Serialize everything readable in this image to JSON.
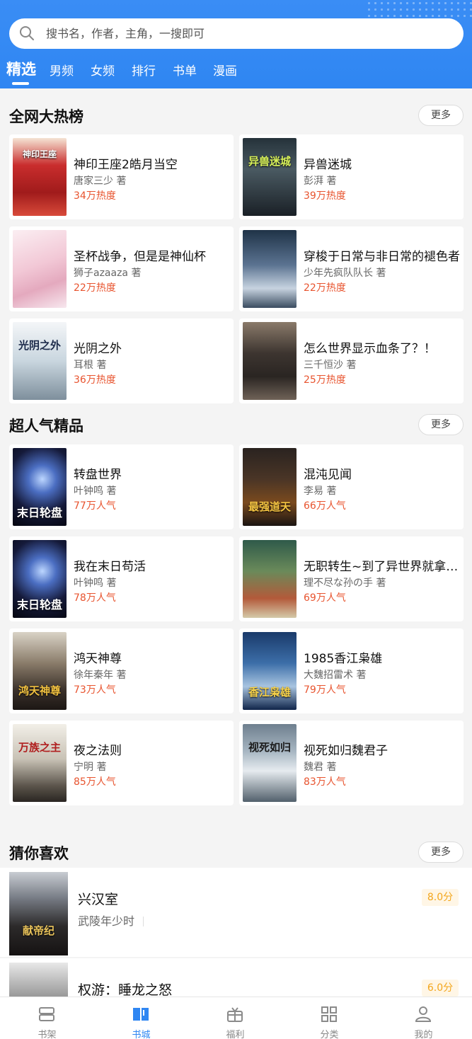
{
  "search": {
    "placeholder": "搜书名，作者，主角，一搜即可"
  },
  "tabs": [
    {
      "label": "精选",
      "active": true
    },
    {
      "label": "男频"
    },
    {
      "label": "女频"
    },
    {
      "label": "排行"
    },
    {
      "label": "书单"
    },
    {
      "label": "漫画"
    }
  ],
  "hot": {
    "title": "全网大热榜",
    "more": "更多",
    "books": [
      {
        "title": "神印王座2皓月当空",
        "author": "唐家三少 著",
        "stat": "34万热度",
        "cover_text": "神印王座"
      },
      {
        "title": "异兽迷城",
        "author": "彭湃 著",
        "stat": "39万热度",
        "cover_text": "异兽迷城"
      },
      {
        "title": "圣杯战争，但是是神仙杯",
        "author": "狮子azaaza 著",
        "stat": "22万热度",
        "cover_text": ""
      },
      {
        "title": "穿梭于日常与非日常的褪色者",
        "author": "少年先疯队队长 著",
        "stat": "22万热度",
        "cover_text": ""
      },
      {
        "title": "光阴之外",
        "author": "耳根 著",
        "stat": "36万热度",
        "cover_text": "光阴之外"
      },
      {
        "title": "怎么世界显示血条了？！",
        "author": "三千恒沙 著",
        "stat": "25万热度",
        "cover_text": ""
      }
    ]
  },
  "popular": {
    "title": "超人气精品",
    "more": "更多",
    "books": [
      {
        "title": "转盘世界",
        "author": "叶钟鸣 著",
        "stat": "77万人气",
        "cover_text": "末日轮盘"
      },
      {
        "title": "混沌见闻",
        "author": "李易 著",
        "stat": "66万人气",
        "cover_text": "最强道天"
      },
      {
        "title": "我在末日苟活",
        "author": "叶钟鸣 著",
        "stat": "78万人气",
        "cover_text": "末日轮盘"
      },
      {
        "title": "无职转生~到了异世界就拿出真本事~",
        "author": "理不尽な孙の手 著",
        "stat": "69万人气",
        "cover_text": ""
      },
      {
        "title": "鸿天神尊",
        "author": "徐年秦年 著",
        "stat": "73万人气",
        "cover_text": "鸿天神尊"
      },
      {
        "title": "1985香江枭雄",
        "author": "大魏招雷术 著",
        "stat": "79万人气",
        "cover_text": "香江枭雄"
      },
      {
        "title": "夜之法则",
        "author": "宁明 著",
        "stat": "85万人气",
        "cover_text": "万族之主"
      },
      {
        "title": "视死如归魏君子",
        "author": "魏君 著",
        "stat": "83万人气",
        "cover_text": "视死如归"
      }
    ]
  },
  "guess": {
    "title": "猜你喜欢",
    "more": "更多",
    "books": [
      {
        "title": "兴汉室",
        "author": "武陵年少时",
        "score": "8.0分",
        "cover_text": "献帝纪"
      },
      {
        "title": "权游：睡龙之怒",
        "author": "",
        "score": "6.0分",
        "cover_text": ""
      }
    ]
  },
  "nav": [
    {
      "label": "书架",
      "icon": "bookshelf-icon"
    },
    {
      "label": "书城",
      "icon": "book-city-icon",
      "active": true
    },
    {
      "label": "福利",
      "icon": "gift-icon"
    },
    {
      "label": "分类",
      "icon": "category-grid-icon"
    },
    {
      "label": "我的",
      "icon": "user-icon"
    }
  ],
  "colors": {
    "primary": "#2f86f2",
    "hot": "#e8542f",
    "score": "#f3a61c"
  }
}
